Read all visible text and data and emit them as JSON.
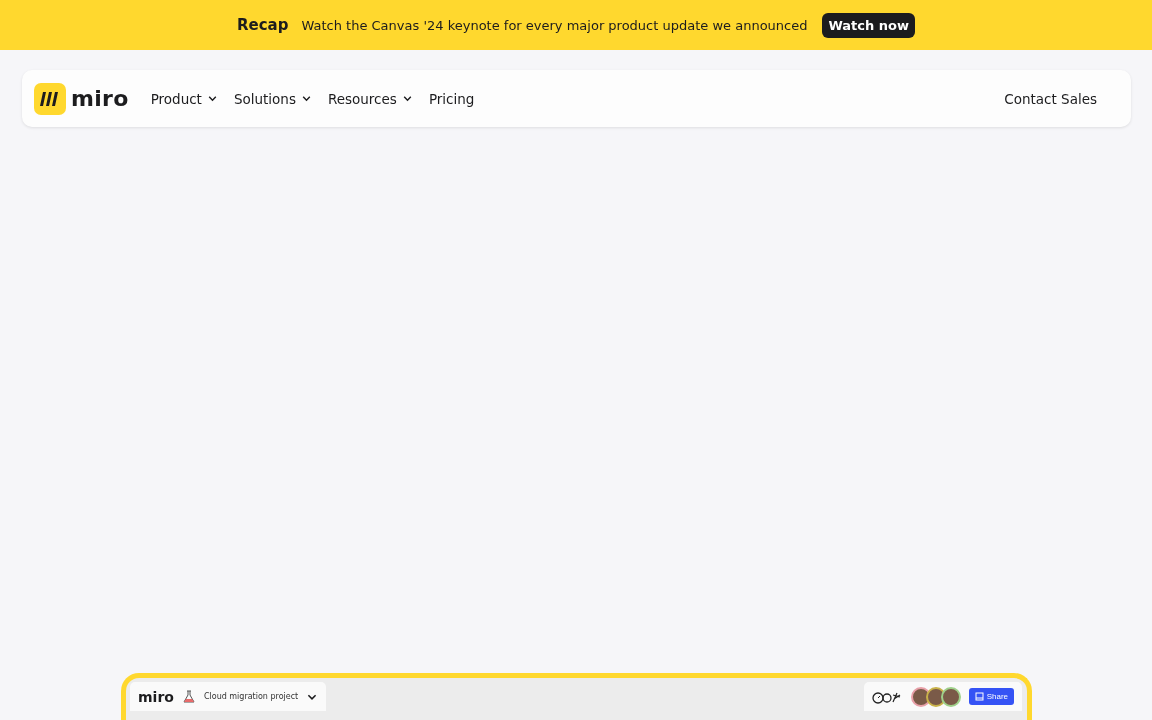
{
  "banner": {
    "title": "Recap",
    "message": "Watch the Canvas '24 keynote for every major product update we announced",
    "button": "Watch now"
  },
  "nav": {
    "logo": "miro",
    "items": [
      {
        "label": "Product",
        "dropdown": true
      },
      {
        "label": "Solutions",
        "dropdown": true
      },
      {
        "label": "Resources",
        "dropdown": true
      },
      {
        "label": "Pricing",
        "dropdown": false
      }
    ],
    "contact": "Contact Sales"
  },
  "preview": {
    "logo": "miro",
    "board_name": "Cloud migration project",
    "avatars": [
      {
        "color": "#e8a0a8"
      },
      {
        "color": "#c9b24a"
      },
      {
        "color": "#9fd08a"
      }
    ],
    "share": "Share"
  }
}
